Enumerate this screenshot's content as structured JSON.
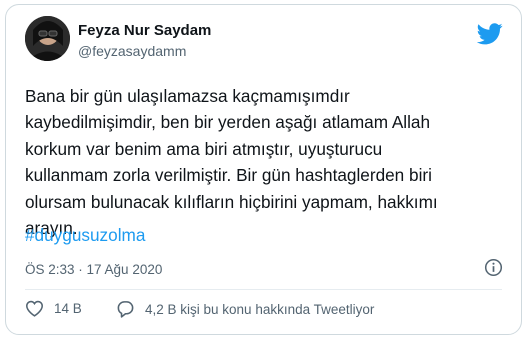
{
  "tweet": {
    "name": "Feyza Nur Saydam",
    "handle": "@feyzasaydamm",
    "text": "Bana bir gün ulaşılamazsa kaçmamışımdır\nkaybedilmişimdir, ben bir yerden aşağı atlamam Allah\nkorkum var  benim ama biri atmıştır, uyuşturucu\nkullanmam zorla verilmiştir. Bir gün hashtaglerden biri\nolursam bulunacak kılıfların hiçbirini yapmam, hakkımı\narayın.",
    "hashtag": "#duygusuzolma",
    "timestamp": "ÖS 2:33 · 17 Ağu 2020",
    "likes": "14 B",
    "people_talking": "4,2 B kişi bu konu hakkında Tweetliyor"
  },
  "colors": {
    "accent": "#1d9bf0",
    "text": "#0f1419",
    "muted": "#536471",
    "border": "#cfd9de"
  },
  "icons": [
    "avatar",
    "twitter-bird-icon",
    "info-icon",
    "heart-icon",
    "reply-bubble-icon"
  ]
}
